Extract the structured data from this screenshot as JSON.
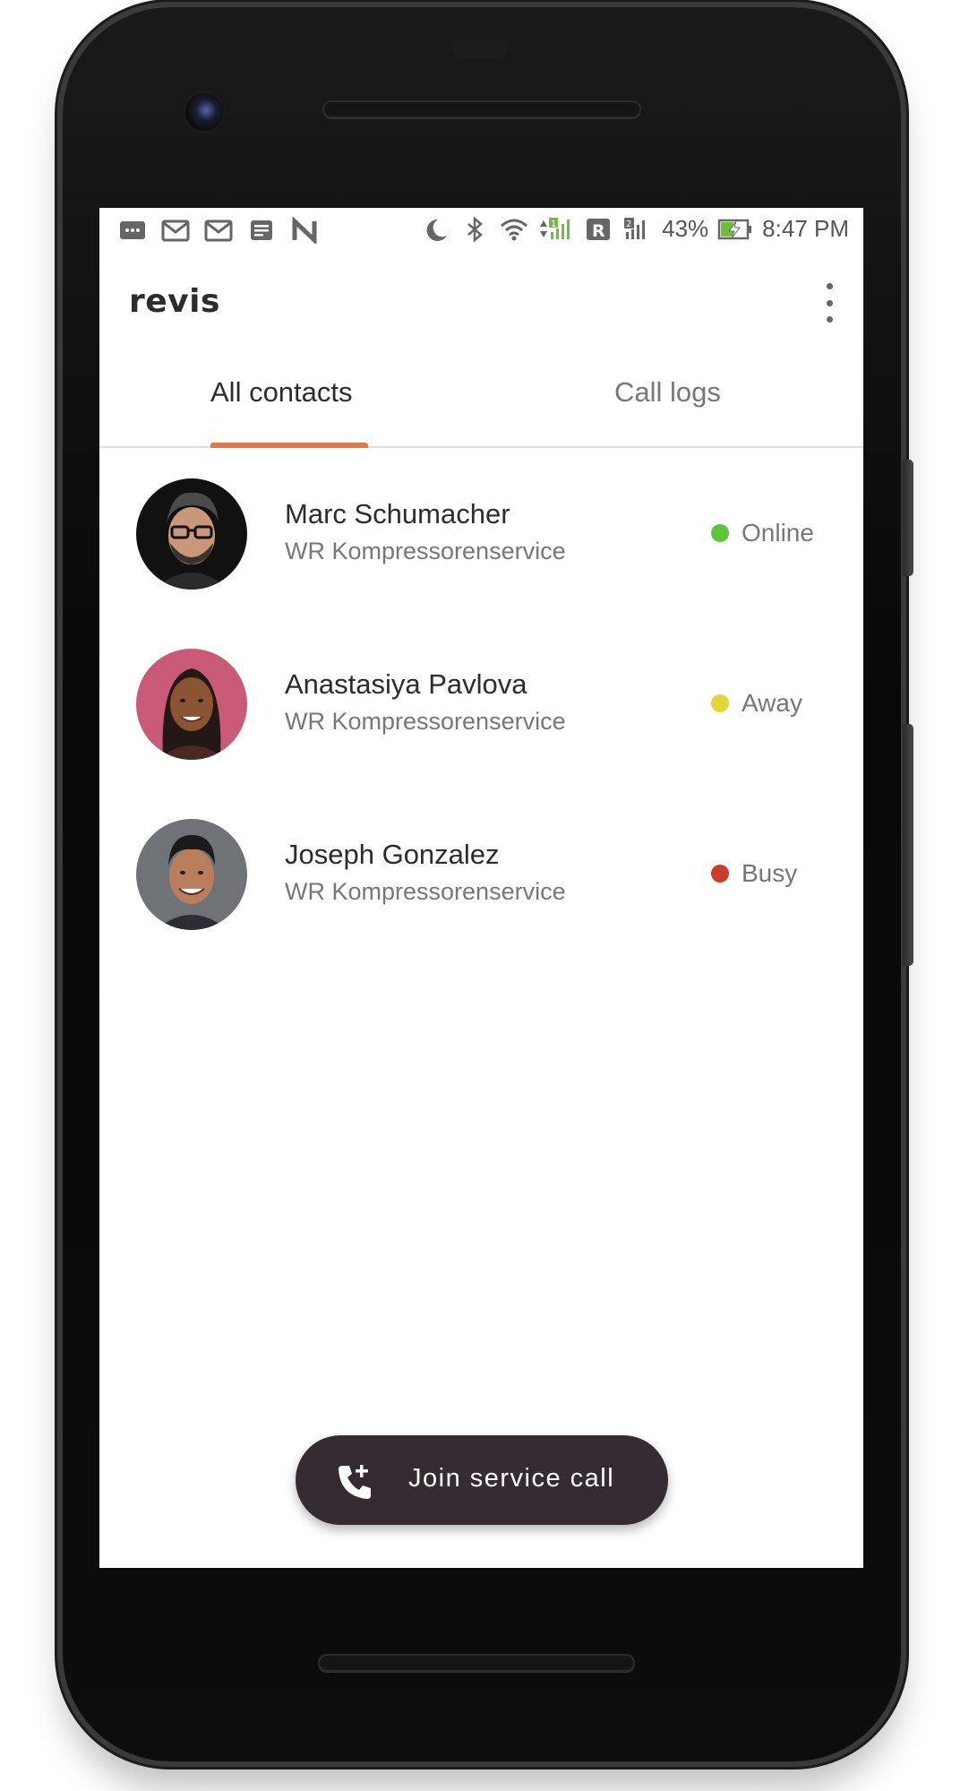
{
  "status_bar": {
    "battery_percent": "43%",
    "time": "8:47 PM",
    "sim1_label": "1",
    "sim2_label": "2",
    "roaming_label": "R"
  },
  "app_bar": {
    "title": "revis"
  },
  "tabs": [
    {
      "label": "All contacts",
      "active": true
    },
    {
      "label": "Call logs",
      "active": false
    }
  ],
  "contacts": [
    {
      "name": "Marc Schumacher",
      "company": "WR Kompressorenservice",
      "status": "Online",
      "status_color": "#5cc63a"
    },
    {
      "name": "Anastasiya Pavlova",
      "company": "WR Kompressorenservice",
      "status": "Away",
      "status_color": "#e0d63a"
    },
    {
      "name": "Joseph Gonzalez",
      "company": "WR Kompressorenservice",
      "status": "Busy",
      "status_color": "#cc3b2c"
    }
  ],
  "fab": {
    "label": "Join service call",
    "icon": "add-call-icon"
  },
  "colors": {
    "accent": "#e07a4a",
    "fab_background": "#352b32",
    "title_text": "#2f2a30"
  }
}
